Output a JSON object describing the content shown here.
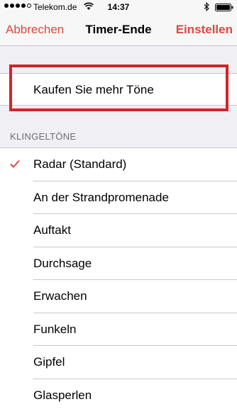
{
  "status_bar": {
    "carrier": "Telekom.de",
    "time": "14:37",
    "signal_icon": "signal-dots-icon",
    "wifi_icon": "wifi-icon",
    "bluetooth_icon": "bluetooth-icon",
    "battery_icon": "battery-icon"
  },
  "nav": {
    "cancel_label": "Abbrechen",
    "title": "Timer-Ende",
    "set_label": "Einstellen"
  },
  "store": {
    "label": "Kaufen Sie mehr Töne"
  },
  "ringtones": {
    "header": "KLINGELTÖNE",
    "items": [
      {
        "label": "Radar (Standard)",
        "selected": true
      },
      {
        "label": "An der Strandpromenade",
        "selected": false
      },
      {
        "label": "Auftakt",
        "selected": false
      },
      {
        "label": "Durchsage",
        "selected": false
      },
      {
        "label": "Erwachen",
        "selected": false
      },
      {
        "label": "Funkeln",
        "selected": false
      },
      {
        "label": "Gipfel",
        "selected": false
      },
      {
        "label": "Glasperlen",
        "selected": false
      }
    ]
  },
  "colors": {
    "accent": "#e0473e",
    "highlight_frame": "#d1242c",
    "background": "#efeff4"
  }
}
